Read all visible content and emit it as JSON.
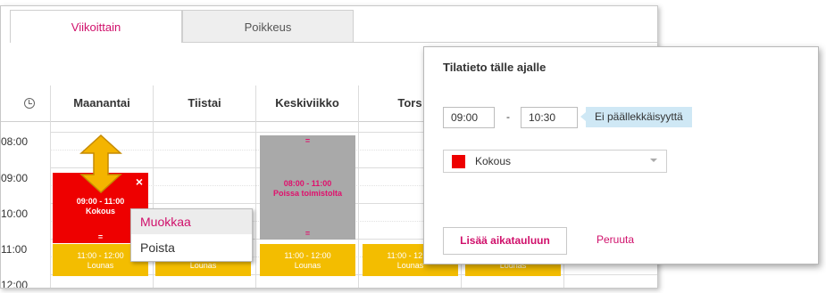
{
  "tabs": [
    {
      "label": "Viikoittain",
      "active": true
    },
    {
      "label": "Poikkeus",
      "active": false
    }
  ],
  "calendar": {
    "days": [
      "Maanantai",
      "Tiistai",
      "Keskiviikko",
      "Tors"
    ],
    "times": [
      "08:00",
      "09:00",
      "10:00",
      "11:00",
      "12:00"
    ],
    "events": {
      "red": {
        "handle": "=",
        "time": "09:00 - 11:00",
        "title": "Kokous",
        "close": "×",
        "bottom_handle": "="
      },
      "gray": {
        "handle": "=",
        "time": "08:00 - 11:00",
        "title": "Poissa toimistolta",
        "bottom_handle": "="
      },
      "lunch": {
        "time": "11:00 - 12:00",
        "title": "Lounas",
        "handle": "="
      }
    }
  },
  "context_menu": {
    "items": [
      "Muokkaa",
      "Poista"
    ]
  },
  "dialog": {
    "title": "Tilatieto tälle ajalle",
    "start": "09:00",
    "separator": "-",
    "end": "10:30",
    "tooltip": "Ei päällekkäisyyttä",
    "status": "Kokous",
    "status_color": "#ee0000",
    "add_button": "Lisää aikatauluun",
    "cancel": "Peruuta"
  },
  "colors": {
    "accent": "#d0106b",
    "meeting": "#ee0000",
    "away": "#a9a9a9",
    "lunch": "#f3bd00"
  }
}
